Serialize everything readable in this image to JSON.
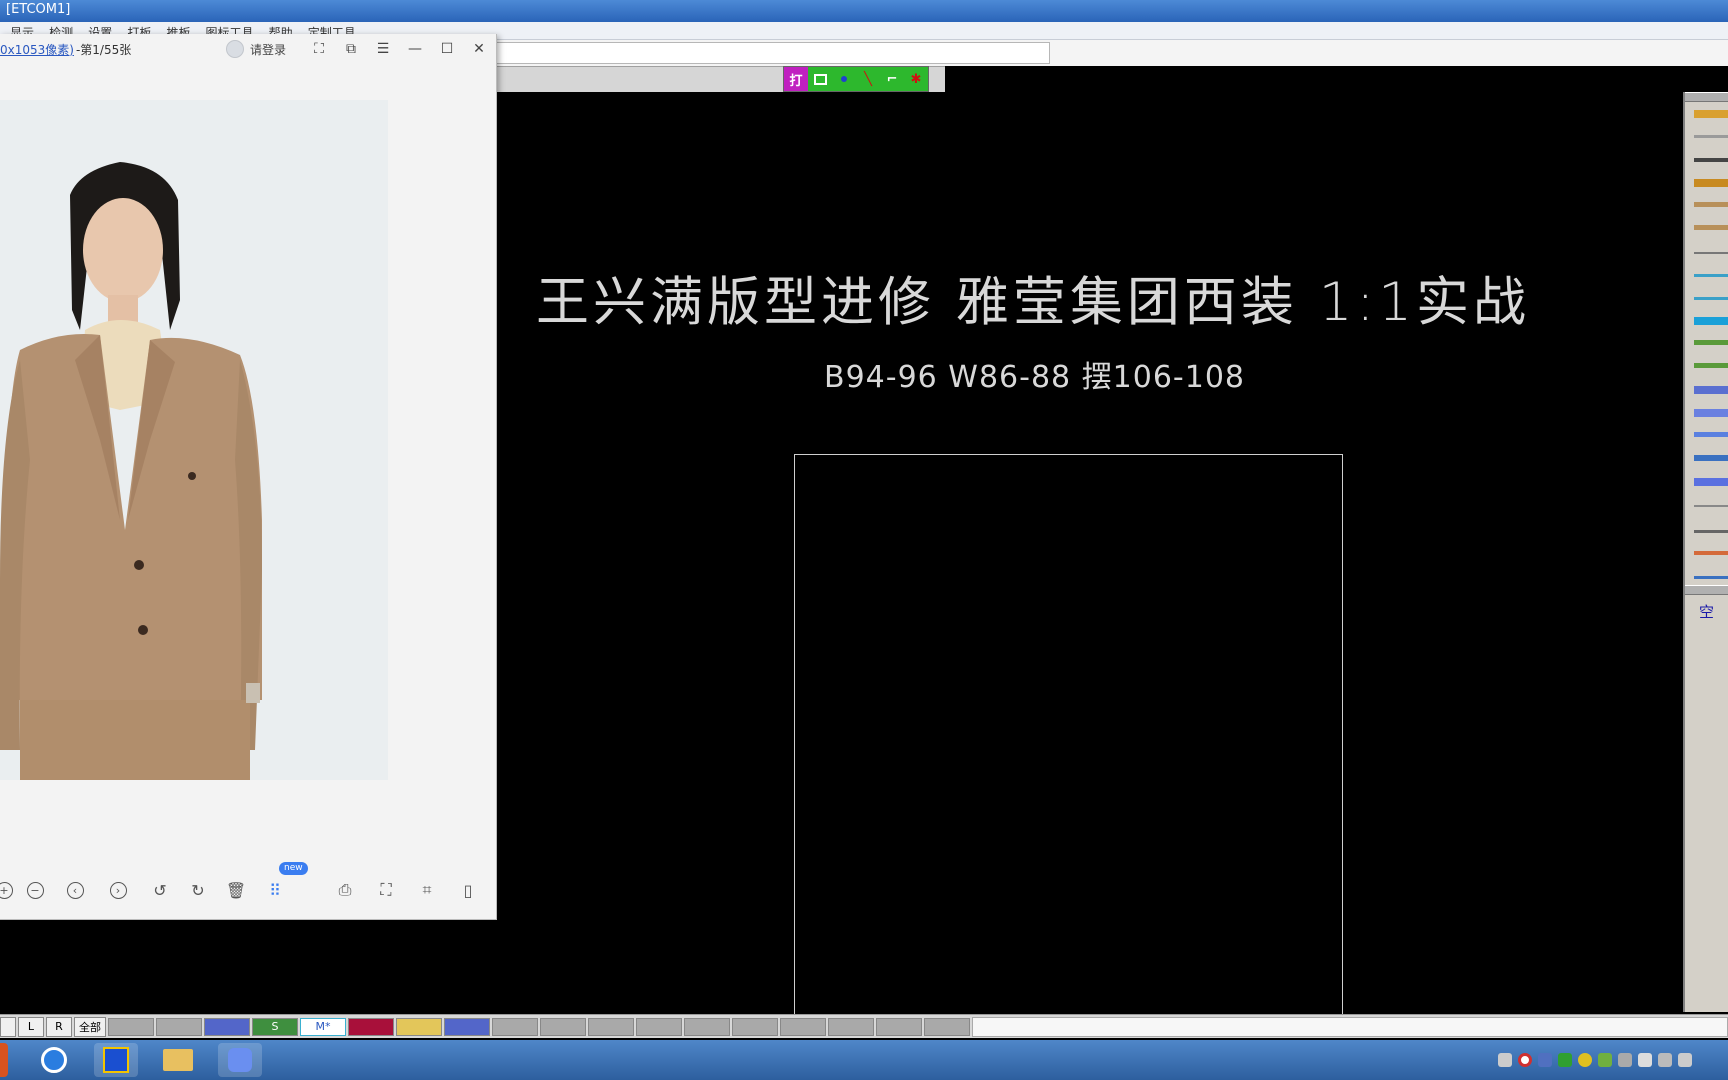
{
  "window": {
    "title": "[ETCOM1]"
  },
  "menu": [
    "显示",
    "检测",
    "设置",
    "打板",
    "推板",
    "图标工具",
    "帮助",
    "定制工具"
  ],
  "mini_tools": [
    "打",
    "rect-tool",
    "point-tool",
    "line-tool",
    "angle-tool",
    "delete-tool"
  ],
  "canvas": {
    "title": "王兴满版型进修    雅莹集团西装    1:1实战",
    "subtitle": "B94-96    W86-88    摆106-108"
  },
  "toolbox": {
    "label": "空"
  },
  "viewer": {
    "file_link": "0x1053像素)",
    "file_info": " -第1/55张",
    "login": "请登录",
    "new_badge": "new",
    "toolbar_icons": [
      "zoom-in-icon",
      "zoom-out-icon",
      "prev-icon",
      "next-icon",
      "rotate-left-icon",
      "rotate-right-icon",
      "delete-icon",
      "apps-icon",
      "print-icon",
      "crop-icon",
      "scan-icon",
      "save-icon"
    ]
  },
  "colorbar": {
    "labels": [
      "L",
      "R",
      "全部"
    ],
    "swatches": [
      {
        "color": "#a9a9a9",
        "text": ""
      },
      {
        "color": "#a9a9a9",
        "text": ""
      },
      {
        "color": "#5366c9",
        "text": ""
      },
      {
        "color": "#3f8f3f",
        "text": "S"
      },
      {
        "color": "#ffffff",
        "text": "M*"
      },
      {
        "color": "#a8103a",
        "text": ""
      },
      {
        "color": "#e3c65a",
        "text": ""
      },
      {
        "color": "#5366c9",
        "text": ""
      },
      {
        "color": "#a9a9a9",
        "text": ""
      },
      {
        "color": "#a9a9a9",
        "text": ""
      },
      {
        "color": "#a9a9a9",
        "text": ""
      },
      {
        "color": "#a9a9a9",
        "text": ""
      },
      {
        "color": "#a9a9a9",
        "text": ""
      },
      {
        "color": "#a9a9a9",
        "text": ""
      },
      {
        "color": "#a9a9a9",
        "text": ""
      },
      {
        "color": "#a9a9a9",
        "text": ""
      },
      {
        "color": "#a9a9a9",
        "text": ""
      },
      {
        "color": "#a9a9a9",
        "text": ""
      }
    ]
  }
}
